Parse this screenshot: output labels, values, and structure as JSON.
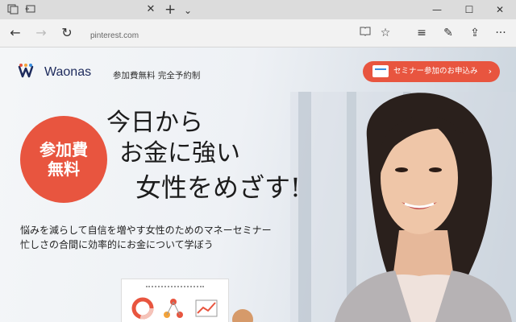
{
  "browser": {
    "url": "pinterest.com"
  },
  "site": {
    "logo_text": "Waonas",
    "tagline": "参加費無料  完全予約制",
    "cta_label": "セミナー参加のお申込み",
    "cta_arrow": "›"
  },
  "hero": {
    "badge_lines": [
      "参加費",
      "無料"
    ],
    "headline_lines": [
      "今日から",
      "お金に強い",
      "女性をめざす!"
    ],
    "sub_lines": [
      "悩みを減らして自信を増やす女性のためのマネーセミナー",
      "忙しさの合間に効率的にお金について学ぼう"
    ]
  },
  "colors": {
    "accent": "#e8553f",
    "brand_navy": "#1d2a5c"
  }
}
